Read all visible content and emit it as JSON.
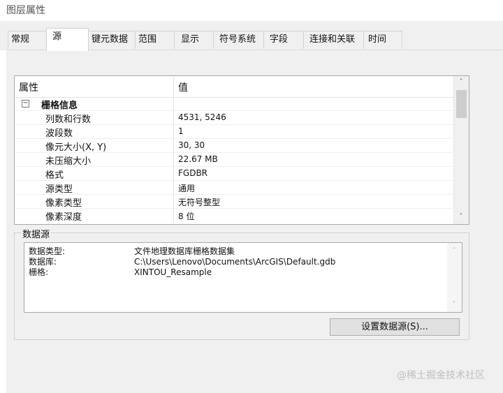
{
  "window": {
    "title": "图层属性"
  },
  "tabs": [
    {
      "label": "常规"
    },
    {
      "label": "源",
      "active": true
    },
    {
      "label": "键元数据"
    },
    {
      "label": "范围"
    },
    {
      "label": "显示"
    },
    {
      "label": "符号系统"
    },
    {
      "label": "字段"
    },
    {
      "label": "连接和关联"
    },
    {
      "label": "时间"
    }
  ],
  "grid": {
    "col_property": "属性",
    "col_value": "值",
    "category": {
      "label": "栅格信息",
      "toggle": "−"
    },
    "rows": [
      {
        "key": "列数和行数",
        "value": "4531, 5246"
      },
      {
        "key": "波段数",
        "value": "1"
      },
      {
        "key": "像元大小(X, Y)",
        "value": "30, 30"
      },
      {
        "key": "未压缩大小",
        "value": "22.67 MB"
      },
      {
        "key": "格式",
        "value": "FGDBR"
      },
      {
        "key": "源类型",
        "value": "通用"
      },
      {
        "key": "像素类型",
        "value": "无符号整型"
      },
      {
        "key": "像素深度",
        "value": "8 位"
      }
    ],
    "scroll_up": "˄",
    "scroll_down": "˅"
  },
  "data_source": {
    "group_label": "数据源",
    "lines": [
      {
        "key": "数据类型:",
        "value": "文件地理数据库栅格数据集"
      },
      {
        "key": "数据库:",
        "value": "C:\\Users\\Lenovo\\Documents\\ArcGIS\\Default.gdb"
      },
      {
        "key": "栅格:",
        "value": "XINTOU_Resample"
      }
    ],
    "scroll_up": "˄",
    "scroll_down": "˅",
    "set_button": "设置数据源(S)..."
  },
  "watermark": "@稀土掘金技术社区"
}
